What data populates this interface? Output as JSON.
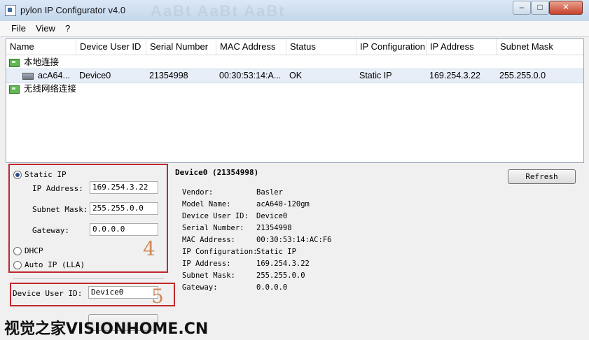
{
  "window": {
    "title": "pylon IP Configurator v4.0",
    "ghost_title": "AaBt AaBt AaBt"
  },
  "menu": {
    "file": "File",
    "view": "View",
    "help": "?"
  },
  "list": {
    "columns": [
      "Name",
      "Device User ID",
      "Serial Number",
      "MAC Address",
      "Status",
      "IP Configuration",
      "IP Address",
      "Subnet Mask"
    ],
    "adapter1": "本地连接",
    "device": {
      "name": "acA64...",
      "user_id": "Device0",
      "serial": "21354998",
      "mac": "00:30:53:14:A...",
      "status": "OK",
      "ip_config": "Static IP",
      "ip": "169.254.3.22",
      "mask": "255.255.0.0"
    },
    "adapter2": "无线网络连接"
  },
  "config": {
    "static_ip_label": "Static IP",
    "ip_label": "IP Address:",
    "ip_value": "169.254.3.22",
    "mask_label": "Subnet Mask:",
    "mask_value": "255.255.0.0",
    "gateway_label": "Gateway:",
    "gateway_value": "0.0.0.0",
    "dhcp_label": "DHCP",
    "autoip_label": "Auto IP (LLA)",
    "user_id_label": "Device User ID:",
    "user_id_value": "Device0",
    "marker4": "4",
    "marker5": "5"
  },
  "info": {
    "heading": "Device0 (21354998)",
    "refresh": "Refresh",
    "rows": [
      {
        "k": "Vendor:",
        "v": "Basler"
      },
      {
        "k": "Model Name:",
        "v": "acA640-120gm"
      },
      {
        "k": "Device User ID:",
        "v": "Device0"
      },
      {
        "k": "Serial Number:",
        "v": "21354998"
      },
      {
        "k": "MAC Address:",
        "v": "00:30:53:14:AC:F6"
      },
      {
        "k": "IP Configuration:",
        "v": "Static IP"
      },
      {
        "k": "IP Address:",
        "v": "169.254.3.22"
      },
      {
        "k": "Subnet Mask:",
        "v": "255.255.0.0"
      },
      {
        "k": "Gateway:",
        "v": "0.0.0.0"
      }
    ]
  },
  "watermark": "视觉之家VISIONHOME.CN"
}
